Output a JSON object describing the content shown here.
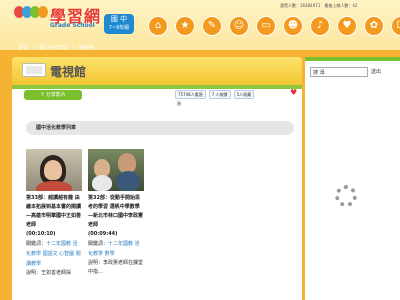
{
  "header": {
    "logo_text": "學習網",
    "logo_sub": "Grade School",
    "grade_line1": "國 中",
    "grade_line2": "7~9年級",
    "visitor_text": "瀏覽人數：16484971　最後上線人數：42",
    "nav_icons": [
      "home-icon",
      "star-icon",
      "book-icon",
      "teacher-icon",
      "tv-icon",
      "people-icon",
      "megaphone-icon",
      "heart-icon",
      "puzzle-icon",
      "dice-icon"
    ],
    "nav_glyphs": [
      "⌂",
      "★",
      "✎",
      "☺",
      "▭",
      "☻",
      "♪",
      "♥",
      "✿",
      "⚀"
    ]
  },
  "breadcrumb": [
    "首頁",
    ">",
    "國小3-6年級",
    ">",
    "電視館"
  ],
  "main": {
    "page_title": "電視館",
    "share_button": "↑ 分享影片",
    "stats": [
      "75748人看過",
      "7 人按讚",
      "5人收藏"
    ],
    "stats_tail": "過",
    "section_title": "國中活化教學列車",
    "cards": [
      {
        "title": "第33部：越讀越有趣 由繪本拓展到基本書的閱讀—高雄市明華國中王如善老師",
        "duration": "(00:10:10)",
        "tags_label": "關鍵詞：",
        "tags": "十二年國教 活化教學 國語文 心智圖 閱讀教學",
        "desc": "說明：王如善老師採"
      },
      {
        "title": "第32部：從動手開始思考的學習 選帆中學數學—新北市林口國中李政憲老師",
        "duration": "(00:09:44)",
        "tags_label": "關鍵詞：",
        "tags": "十二年國教 活化教學 數學",
        "desc": "說明：李政憲老師在課堂中指..."
      }
    ]
  },
  "sidebar": {
    "search_value": "搜 尋",
    "search_button": "送出"
  },
  "colors": {
    "background": "#f6b232",
    "accent_green": "#7abf2e",
    "link_blue": "#2b7fc1"
  }
}
